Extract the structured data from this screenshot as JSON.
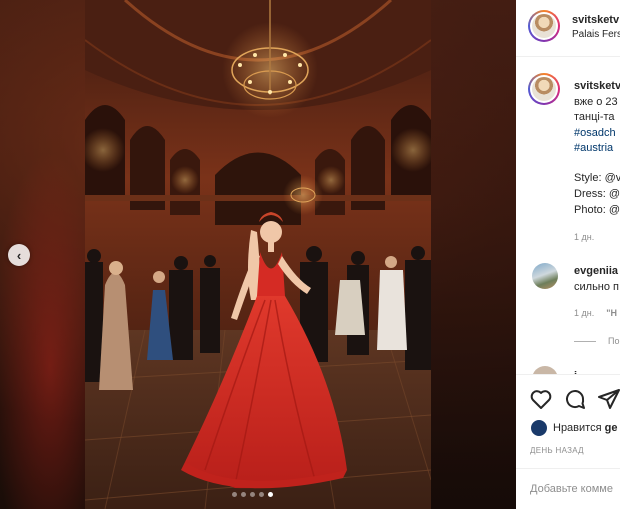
{
  "post": {
    "username": "svitsketv",
    "location": "Palais Fers",
    "carousel": {
      "dots": 5,
      "active_index": 4
    }
  },
  "caption": {
    "username": "svitsketv",
    "lines": [
      "вже о 23",
      "танці-та"
    ],
    "hashtags": [
      "#osadch",
      "#austria"
    ],
    "credits": [
      "Style: @v",
      "Dress: @",
      "Photo: @"
    ],
    "time": "1 дн."
  },
  "comments": [
    {
      "username": "evgeniia",
      "text": "сильно п",
      "time": "1 дн.",
      "reply_label": "\"Н"
    },
    {
      "username": "i"
    }
  ],
  "view_replies": "По",
  "likes": {
    "text": "Нравится",
    "who": "ge"
  },
  "date_label": "ДЕНЬ НАЗАД",
  "comment_box": {
    "placeholder": "Добавьте комме"
  },
  "icons": {
    "prev": "chevron-left-icon",
    "like": "heart-icon",
    "comment": "comment-bubble-icon",
    "share": "paper-plane-icon"
  },
  "colors": {
    "dress": "#d52b24",
    "link": "#00376b",
    "muted": "#8e8e8e"
  }
}
